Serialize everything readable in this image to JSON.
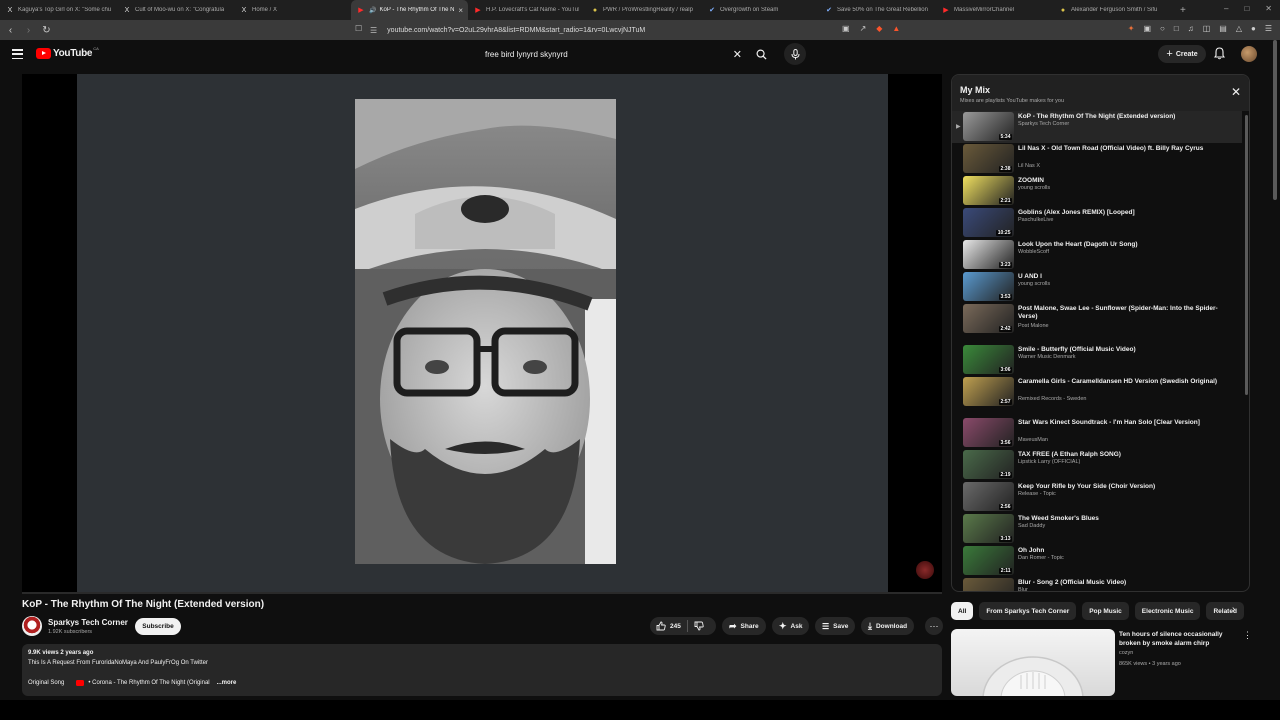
{
  "browser": {
    "tabs": [
      {
        "title": "Kaguya's Top Girl on X: \"Some chu",
        "icon": "x-logo-icon",
        "active": false
      },
      {
        "title": "Cult of Moo-wu on X: \"Congratula",
        "icon": "x-logo-icon",
        "active": false
      },
      {
        "title": "Home / X",
        "icon": "x-logo-icon",
        "active": false
      },
      {
        "title": "KoP - The Rhythm Of The N",
        "icon": "youtube-icon",
        "active": true
      },
      {
        "title": "H.P. Lovecraft's Cat Name - YouTub",
        "icon": "youtube-icon",
        "active": false
      },
      {
        "title": "PWR / ProWrestlingReality / realp",
        "icon": "globe-icon",
        "active": false
      },
      {
        "title": "Overgrowth on Steam",
        "icon": "check-icon",
        "active": false
      },
      {
        "title": "Save 50% on The Great Rebellion",
        "icon": "check-icon",
        "active": false
      },
      {
        "title": "MassiveMirrorChannel",
        "icon": "youtube-icon",
        "active": false
      },
      {
        "title": "Alexander Ferguson Smith / Sifu",
        "icon": "globe-icon",
        "active": false
      }
    ],
    "url": "youtube.com/watch?v=O2uL29vhrA8&list=RDMM&start_radio=1&rv=0LwcvjNJTuM"
  },
  "header": {
    "logo_text": "YouTube",
    "country_code": "CA",
    "search_query": "free bird lynyrd skynyrd",
    "create_label": "Create"
  },
  "video": {
    "title": "KoP - The Rhythm Of The Night (Extended version)",
    "channel": "Sparkys Tech Corner",
    "subscribers": "1.92K subscribers",
    "subscribe_label": "Subscribe",
    "likes": "245",
    "share_label": "Share",
    "ask_label": "Ask",
    "save_label": "Save",
    "download_label": "Download",
    "views_date": "9.9K views  2 years ago",
    "description": "This Is A Request From FuroridaNoMaya And PaulyFrOg On Twitter",
    "original_song_label": "Original Song",
    "original_song": "• Corona - The Rhythm Of The Night (Original",
    "more_label": "...more"
  },
  "mix": {
    "title": "My Mix",
    "subtitle": "Mixes are playlists YouTube makes for you",
    "items": [
      {
        "title": "KoP - The Rhythm Of The Night (Extended version)",
        "channel": "Sparkys Tech Corner",
        "duration": "5:34",
        "color": "#9a9a9a",
        "current": true
      },
      {
        "title": "Lil Nas X - Old Town Road (Official Video) ft. Billy Ray Cyrus",
        "channel": "Lil Nas X",
        "duration": "2:38",
        "color": "#6a5a3a",
        "current": false
      },
      {
        "title": "ZOOMIN",
        "channel": "young scrolls",
        "duration": "2:21",
        "color": "#f0e060",
        "current": false
      },
      {
        "title": "Goblins (Alex Jones REMIX) [Looped]",
        "channel": "PaschulkeLive",
        "duration": "10:25",
        "color": "#3a4a7a",
        "current": false
      },
      {
        "title": "Look Upon the Heart (Dagoth Ur Song)",
        "channel": "WobbleScoff",
        "duration": "3:23",
        "color": "#e8e8e8",
        "current": false
      },
      {
        "title": "U AND I",
        "channel": "young scrolls",
        "duration": "3:53",
        "color": "#5a9ad0",
        "current": false
      },
      {
        "title": "Post Malone, Swae Lee - Sunflower (Spider-Man: Into the Spider-Verse)",
        "channel": "Post Malone",
        "duration": "2:42",
        "color": "#7a6a5a",
        "current": false
      },
      {
        "title": "Smile - Butterfly (Official Music Video)",
        "channel": "Warner Music Denmark",
        "duration": "3:06",
        "color": "#3a8a3a",
        "current": false
      },
      {
        "title": "Caramella Girls - Caramelldansen HD Version (Swedish Original)",
        "channel": "Remixed Records - Sweden",
        "duration": "2:57",
        "color": "#c0a050",
        "current": false
      },
      {
        "title": "Star Wars Kinect Soundtrack - I'm Han Solo [Clear Version]",
        "channel": "MaveusMan",
        "duration": "3:56",
        "color": "#8a4a6a",
        "current": false
      },
      {
        "title": "TAX FREE (A Ethan Ralph SONG)",
        "channel": "Lipstick Larry (OFFICIAL)",
        "duration": "2:19",
        "color": "#4a6a4a",
        "current": false
      },
      {
        "title": "Keep Your Rifle by Your Side (Choir Version)",
        "channel": "Release - Topic",
        "duration": "2:56",
        "color": "#6a6a6a",
        "current": false
      },
      {
        "title": "The Weed Smoker's Blues",
        "channel": "Sad Daddy",
        "duration": "3:13",
        "color": "#5a7a4a",
        "current": false
      },
      {
        "title": "Oh John",
        "channel": "Dan Romer - Topic",
        "duration": "2:11",
        "color": "#3a7a3a",
        "current": false
      },
      {
        "title": "Blur - Song 2 (Official Music Video)",
        "channel": "Blur",
        "duration": "2:03",
        "color": "#6a5a3a",
        "current": false
      }
    ]
  },
  "chips": [
    "All",
    "From Sparkys Tech Corner",
    "Pop Music",
    "Electronic Music",
    "Related"
  ],
  "recommended": {
    "title": "Ten hours of silence occasionally broken by smoke alarm chirp",
    "channel": "cozyn",
    "meta": "865K views • 3 years ago"
  }
}
